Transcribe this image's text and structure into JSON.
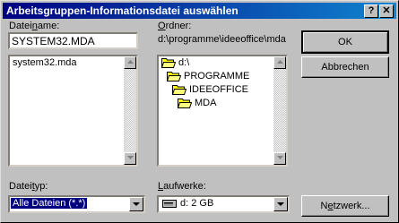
{
  "window": {
    "title": "Arbeitsgruppen-Informationsdatei auswählen"
  },
  "titlebar_buttons": [
    {
      "label": "?",
      "icon": "help-icon"
    },
    {
      "label": "✕",
      "icon": "close-icon"
    }
  ],
  "filename": {
    "label_pre": "Datei",
    "label_u": "n",
    "label_post": "ame:",
    "value": "SYSTEM32.MDA",
    "files": [
      "system32.mda"
    ]
  },
  "folder": {
    "label_pre": "",
    "label_u": "O",
    "label_post": "rdner:",
    "path": "d:\\programme\\ideeoffice\\mda",
    "tree": [
      {
        "name": "d:\\",
        "icon": "open-folder-icon"
      },
      {
        "name": "PROGRAMME",
        "icon": "open-folder-icon"
      },
      {
        "name": "IDEEOFFICE",
        "icon": "open-folder-icon"
      },
      {
        "name": "MDA",
        "icon": "open-folder-icon"
      }
    ]
  },
  "filetype": {
    "label_pre": "Datei",
    "label_u": "t",
    "label_post": "yp:",
    "value": "Alle Dateien (*.*)"
  },
  "drives": {
    "label_pre": "",
    "label_u": "L",
    "label_post": "aufwerke:",
    "value": "d: 2 GB",
    "icon": "hard-drive-icon"
  },
  "buttons": {
    "ok": "OK",
    "cancel": "Abbrechen",
    "network_pre": "N",
    "network_u": "e",
    "network_post": "tzwerk..."
  }
}
